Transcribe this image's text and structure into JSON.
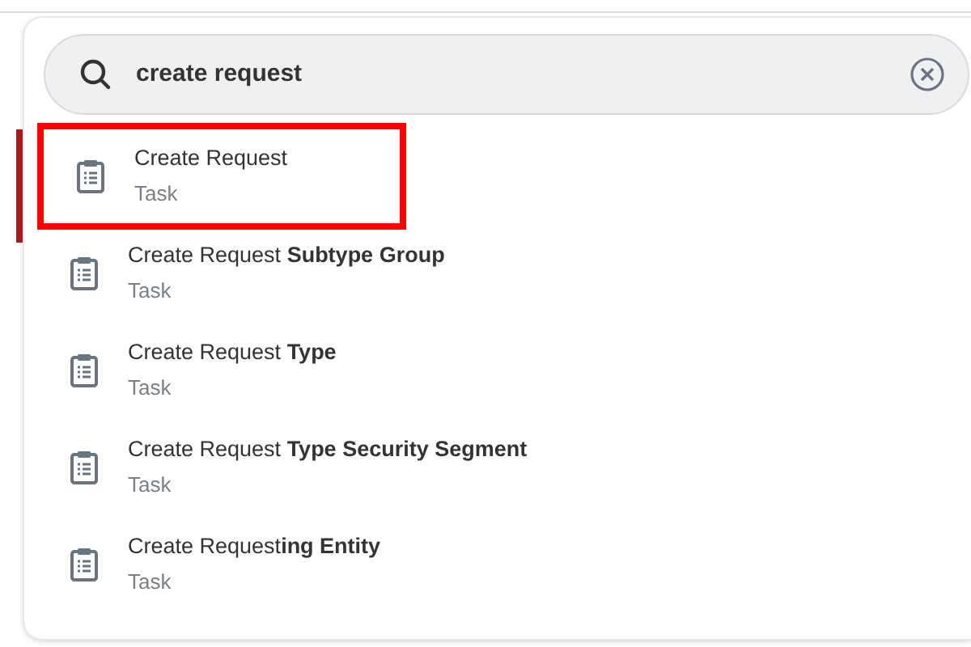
{
  "search": {
    "value": "create request"
  },
  "results": [
    {
      "title": "Create Request",
      "subtitle": "Task",
      "highlighted": true
    },
    {
      "title": "Create Request **Subtype Group**",
      "subtitle": "Task",
      "highlighted": false
    },
    {
      "title": "Create Request **Type**",
      "subtitle": "Task",
      "highlighted": false
    },
    {
      "title": "Create Request **Type Security Segment**",
      "subtitle": "Task",
      "highlighted": false
    },
    {
      "title": "Create Request**ing Entity**",
      "subtitle": "Task",
      "highlighted": false
    }
  ]
}
